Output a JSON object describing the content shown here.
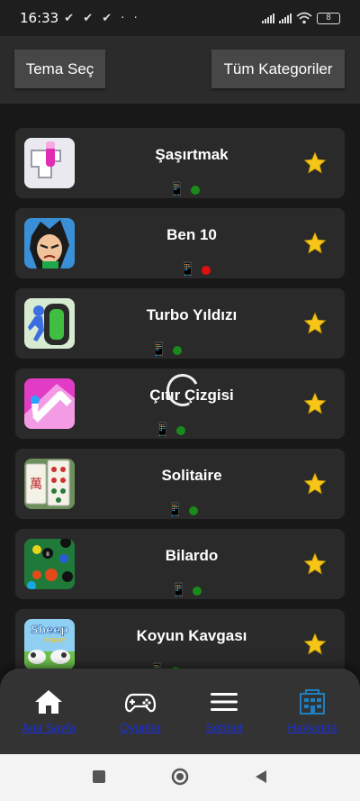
{
  "status_bar": {
    "time": "16:33",
    "notifications": "✔ ✔ ✔ · ·",
    "battery": "8"
  },
  "header": {
    "theme_button": "Tema Seç",
    "categories_button": "Tüm Kategoriler"
  },
  "games": [
    {
      "title": "Şaşırtmak",
      "status": "green",
      "device": "📱"
    },
    {
      "title": "Ben 10",
      "status": "red",
      "device": "📱"
    },
    {
      "title": "Turbo Yıldızı",
      "status": "green",
      "device": "📱"
    },
    {
      "title": "Çıtır Çizgisi",
      "status": "green",
      "device": "📱"
    },
    {
      "title": "Solitaire",
      "status": "green",
      "device": "📱"
    },
    {
      "title": "Bilardo",
      "status": "green",
      "device": "📱"
    },
    {
      "title": "Koyun Kavgası",
      "status": "green",
      "device": "📱"
    }
  ],
  "bottom_nav": [
    {
      "label": "Ana Sayfa",
      "icon": "home-icon"
    },
    {
      "label": "Oyunlar",
      "icon": "gamepad-icon"
    },
    {
      "label": "Sohbet",
      "icon": "menu-icon"
    },
    {
      "label": "Hakkında",
      "icon": "info-building-icon"
    }
  ],
  "colors": {
    "accent_link": "#1a2fd6",
    "status_green": "#1a8a1a",
    "status_red": "#e01010",
    "star": "#f5c518"
  }
}
